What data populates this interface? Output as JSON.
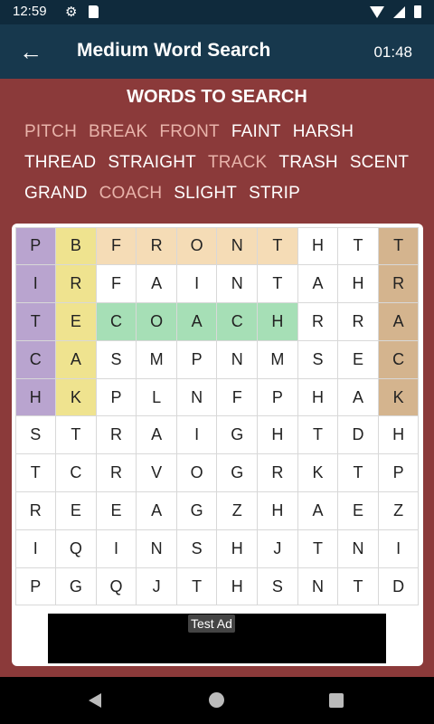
{
  "status_bar": {
    "time": "12:59",
    "gear_icon": "⚙"
  },
  "app_bar": {
    "back_icon": "←",
    "title": "Medium Word Search",
    "timer": "01:48"
  },
  "words_section": {
    "title": "WORDS TO SEARCH",
    "words": [
      {
        "text": "PITCH",
        "found": true
      },
      {
        "text": "BREAK",
        "found": true
      },
      {
        "text": "FRONT",
        "found": true
      },
      {
        "text": "FAINT",
        "found": false
      },
      {
        "text": "HARSH",
        "found": false
      },
      {
        "text": "THREAD",
        "found": false
      },
      {
        "text": "STRAIGHT",
        "found": false
      },
      {
        "text": "TRACK",
        "found": true
      },
      {
        "text": "TRASH",
        "found": false
      },
      {
        "text": "SCENT",
        "found": false
      },
      {
        "text": "GRAND",
        "found": false
      },
      {
        "text": "COACH",
        "found": true
      },
      {
        "text": "SLIGHT",
        "found": false
      },
      {
        "text": "STRIP",
        "found": false
      }
    ]
  },
  "grid": {
    "rows": [
      [
        "P",
        "B",
        "F",
        "R",
        "O",
        "N",
        "T",
        "H",
        "T",
        "T"
      ],
      [
        "I",
        "R",
        "F",
        "A",
        "I",
        "N",
        "T",
        "A",
        "H",
        "R"
      ],
      [
        "T",
        "E",
        "C",
        "O",
        "A",
        "C",
        "H",
        "R",
        "R",
        "A"
      ],
      [
        "C",
        "A",
        "S",
        "M",
        "P",
        "N",
        "M",
        "S",
        "E",
        "C"
      ],
      [
        "H",
        "K",
        "P",
        "L",
        "N",
        "F",
        "P",
        "H",
        "A",
        "K"
      ],
      [
        "S",
        "T",
        "R",
        "A",
        "I",
        "G",
        "H",
        "T",
        "D",
        "H"
      ],
      [
        "T",
        "C",
        "R",
        "V",
        "O",
        "G",
        "R",
        "K",
        "T",
        "P"
      ],
      [
        "R",
        "E",
        "E",
        "A",
        "G",
        "Z",
        "H",
        "A",
        "E",
        "Z"
      ],
      [
        "I",
        "Q",
        "I",
        "N",
        "S",
        "H",
        "J",
        "T",
        "N",
        "I"
      ],
      [
        "P",
        "G",
        "Q",
        "J",
        "T",
        "H",
        "S",
        "N",
        "T",
        "D"
      ]
    ],
    "highlights": [
      {
        "word": "PITCH",
        "color": "#b9a4cf",
        "cells": [
          [
            0,
            0
          ],
          [
            1,
            0
          ],
          [
            2,
            0
          ],
          [
            3,
            0
          ],
          [
            4,
            0
          ]
        ]
      },
      {
        "word": "BREAK",
        "color": "#efe38f",
        "cells": [
          [
            0,
            1
          ],
          [
            1,
            1
          ],
          [
            2,
            1
          ],
          [
            3,
            1
          ],
          [
            4,
            1
          ]
        ]
      },
      {
        "word": "FRONT",
        "color": "#f5dcb6",
        "cells": [
          [
            0,
            2
          ],
          [
            0,
            3
          ],
          [
            0,
            4
          ],
          [
            0,
            5
          ],
          [
            0,
            6
          ]
        ]
      },
      {
        "word": "COACH",
        "color": "#a6dfb6",
        "cells": [
          [
            2,
            2
          ],
          [
            2,
            3
          ],
          [
            2,
            4
          ],
          [
            2,
            5
          ],
          [
            2,
            6
          ]
        ]
      },
      {
        "word": "TRACK",
        "color": "#d4b48e",
        "cells": [
          [
            0,
            9
          ],
          [
            1,
            9
          ],
          [
            2,
            9
          ],
          [
            3,
            9
          ],
          [
            4,
            9
          ]
        ]
      }
    ]
  },
  "ad": {
    "label": "Test Ad"
  }
}
